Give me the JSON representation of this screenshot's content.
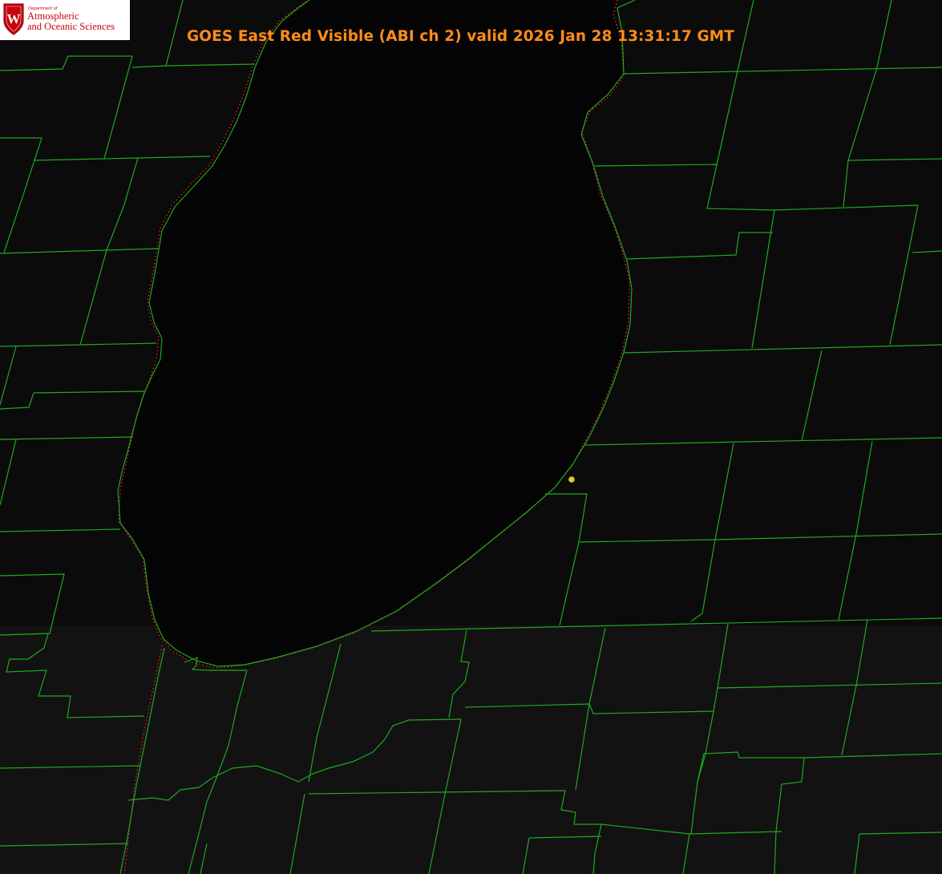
{
  "title": "GOES East Red Visible (ABI ch 2) valid 2026 Jan 28 13:31:17 GMT",
  "logo": {
    "small_text": "Department of",
    "line1": "Atmospheric",
    "line2": "and Oceanic Sciences",
    "crest_letter": "W"
  },
  "colors": {
    "background": "#000000",
    "water": "#050505",
    "county_lines": "#1fa81f",
    "shoreline_dotted": "#ff2020",
    "title": "#ff8c1a",
    "marker": "#e0d020",
    "logo_red": "#c5050c"
  },
  "layers": {
    "satellite_image": "GOES East Red Visible (ABI ch 2)",
    "boundaries": "county-lines",
    "shoreline": "lake-shoreline",
    "marker": "station-marker"
  }
}
